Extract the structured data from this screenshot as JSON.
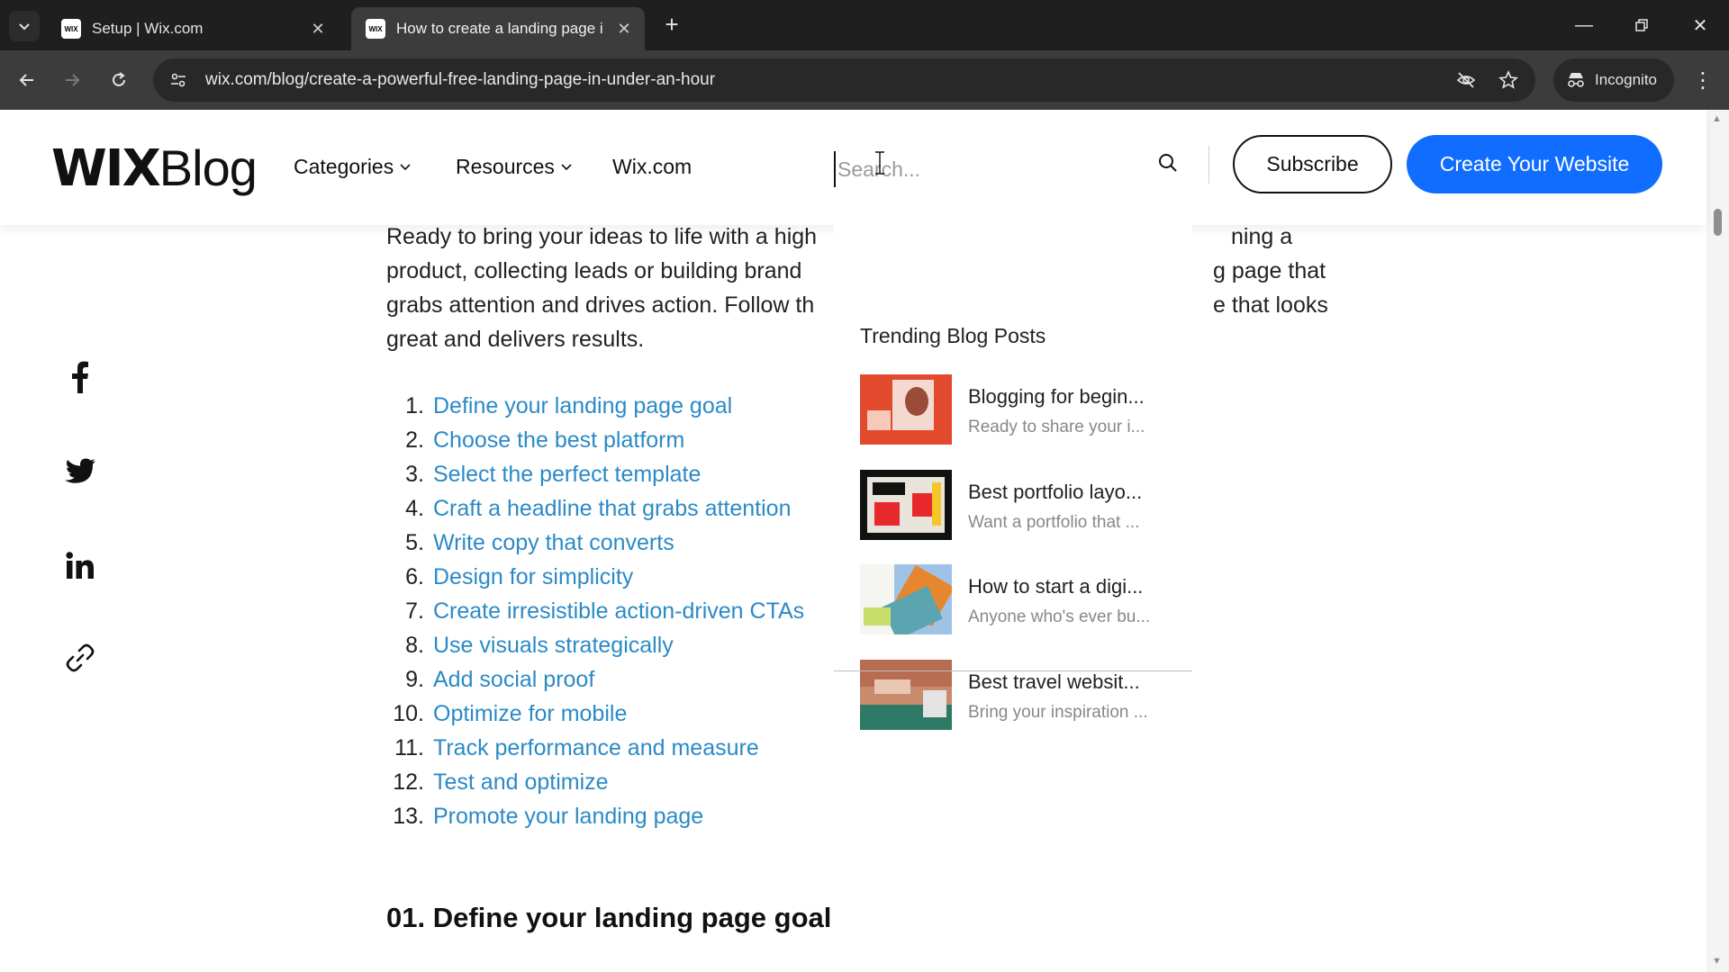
{
  "browser": {
    "tabs": [
      {
        "title": "Setup | Wix.com",
        "favicon": "WIX",
        "active": false
      },
      {
        "title": "How to create a landing page i",
        "favicon": "WIX",
        "active": true
      }
    ],
    "url": "wix.com/blog/create-a-powerful-free-landing-page-in-under-an-hour",
    "incognito_label": "Incognito"
  },
  "header": {
    "logo_wix": "WIX",
    "logo_blog": "Blog",
    "nav": [
      "Categories",
      "Resources",
      "Wix.com"
    ],
    "search_placeholder": "Search...",
    "subscribe_label": "Subscribe",
    "create_label": "Create Your Website",
    "accent_color": "#116dff"
  },
  "article": {
    "intro_left": "Ready to bring your ideas to life with a high",
    "intro_lines": [
      "Ready to bring your ideas to life with a high",
      "product, collecting leads or building brand",
      "grabs attention and drives action. Follow th",
      "great and delivers results."
    ],
    "intro_right_lines": [
      "ning a",
      "g page that",
      "e that looks"
    ],
    "toc": [
      "Define your landing page goal",
      "Choose the best platform",
      "Select the perfect template",
      "Craft a headline that grabs attention",
      "Write copy that converts",
      "Design for simplicity",
      "Create irresistible action-driven CTAs",
      "Use visuals strategically",
      "Add social proof",
      "Optimize for mobile",
      "Track performance and measure",
      "Test and optimize",
      "Promote your landing page"
    ],
    "section_heading": "01. Define your landing page goal",
    "link_color": "#2b8ac6"
  },
  "share": [
    "facebook-icon",
    "twitter-icon",
    "linkedin-icon",
    "link-icon"
  ],
  "dropdown": {
    "title": "Trending Blog Posts",
    "items": [
      {
        "title": "Blogging for begin...",
        "desc": "Ready to share your i..."
      },
      {
        "title": "Best portfolio layo...",
        "desc": "Want a portfolio that ..."
      },
      {
        "title": "How to start a digi...",
        "desc": "Anyone who's ever bu..."
      },
      {
        "title": "Best travel websit...",
        "desc": "Bring your inspiration ..."
      }
    ]
  }
}
